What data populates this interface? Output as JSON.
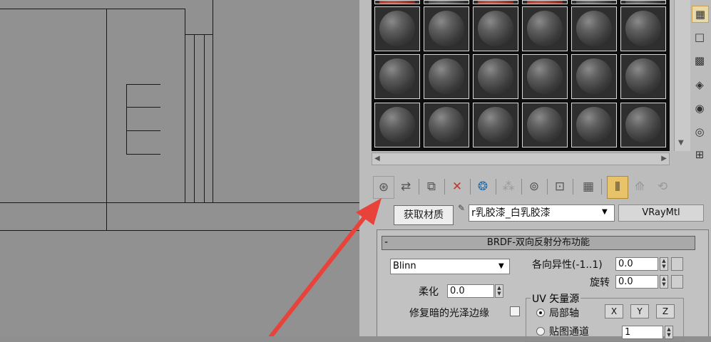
{
  "toolbar": {
    "get_material_tooltip": "获取材质"
  },
  "material": {
    "name": "r乳胶漆_白乳胶漆",
    "type": "VRayMtl"
  },
  "rollout": {
    "toggle": "-",
    "title": "BRDF-双向反射分布功能",
    "shader": "Blinn",
    "soften_label": "柔化",
    "soften_value": "0.0",
    "fix_dark_edges_label": "修复暗的光泽边缘",
    "anisotropy_label": "各向异性(-1..1)",
    "anisotropy_value": "0.0",
    "rotation_label": "旋转",
    "rotation_value": "0.0",
    "uv_source_label": "UV 矢量源",
    "local_axis_label": "局部轴",
    "axis_x": "X",
    "axis_y": "Y",
    "axis_z": "Z",
    "map_channel_label": "贴图通道",
    "map_channel_value": "1"
  },
  "colors": {
    "annotation_arrow": "#e8433a"
  }
}
